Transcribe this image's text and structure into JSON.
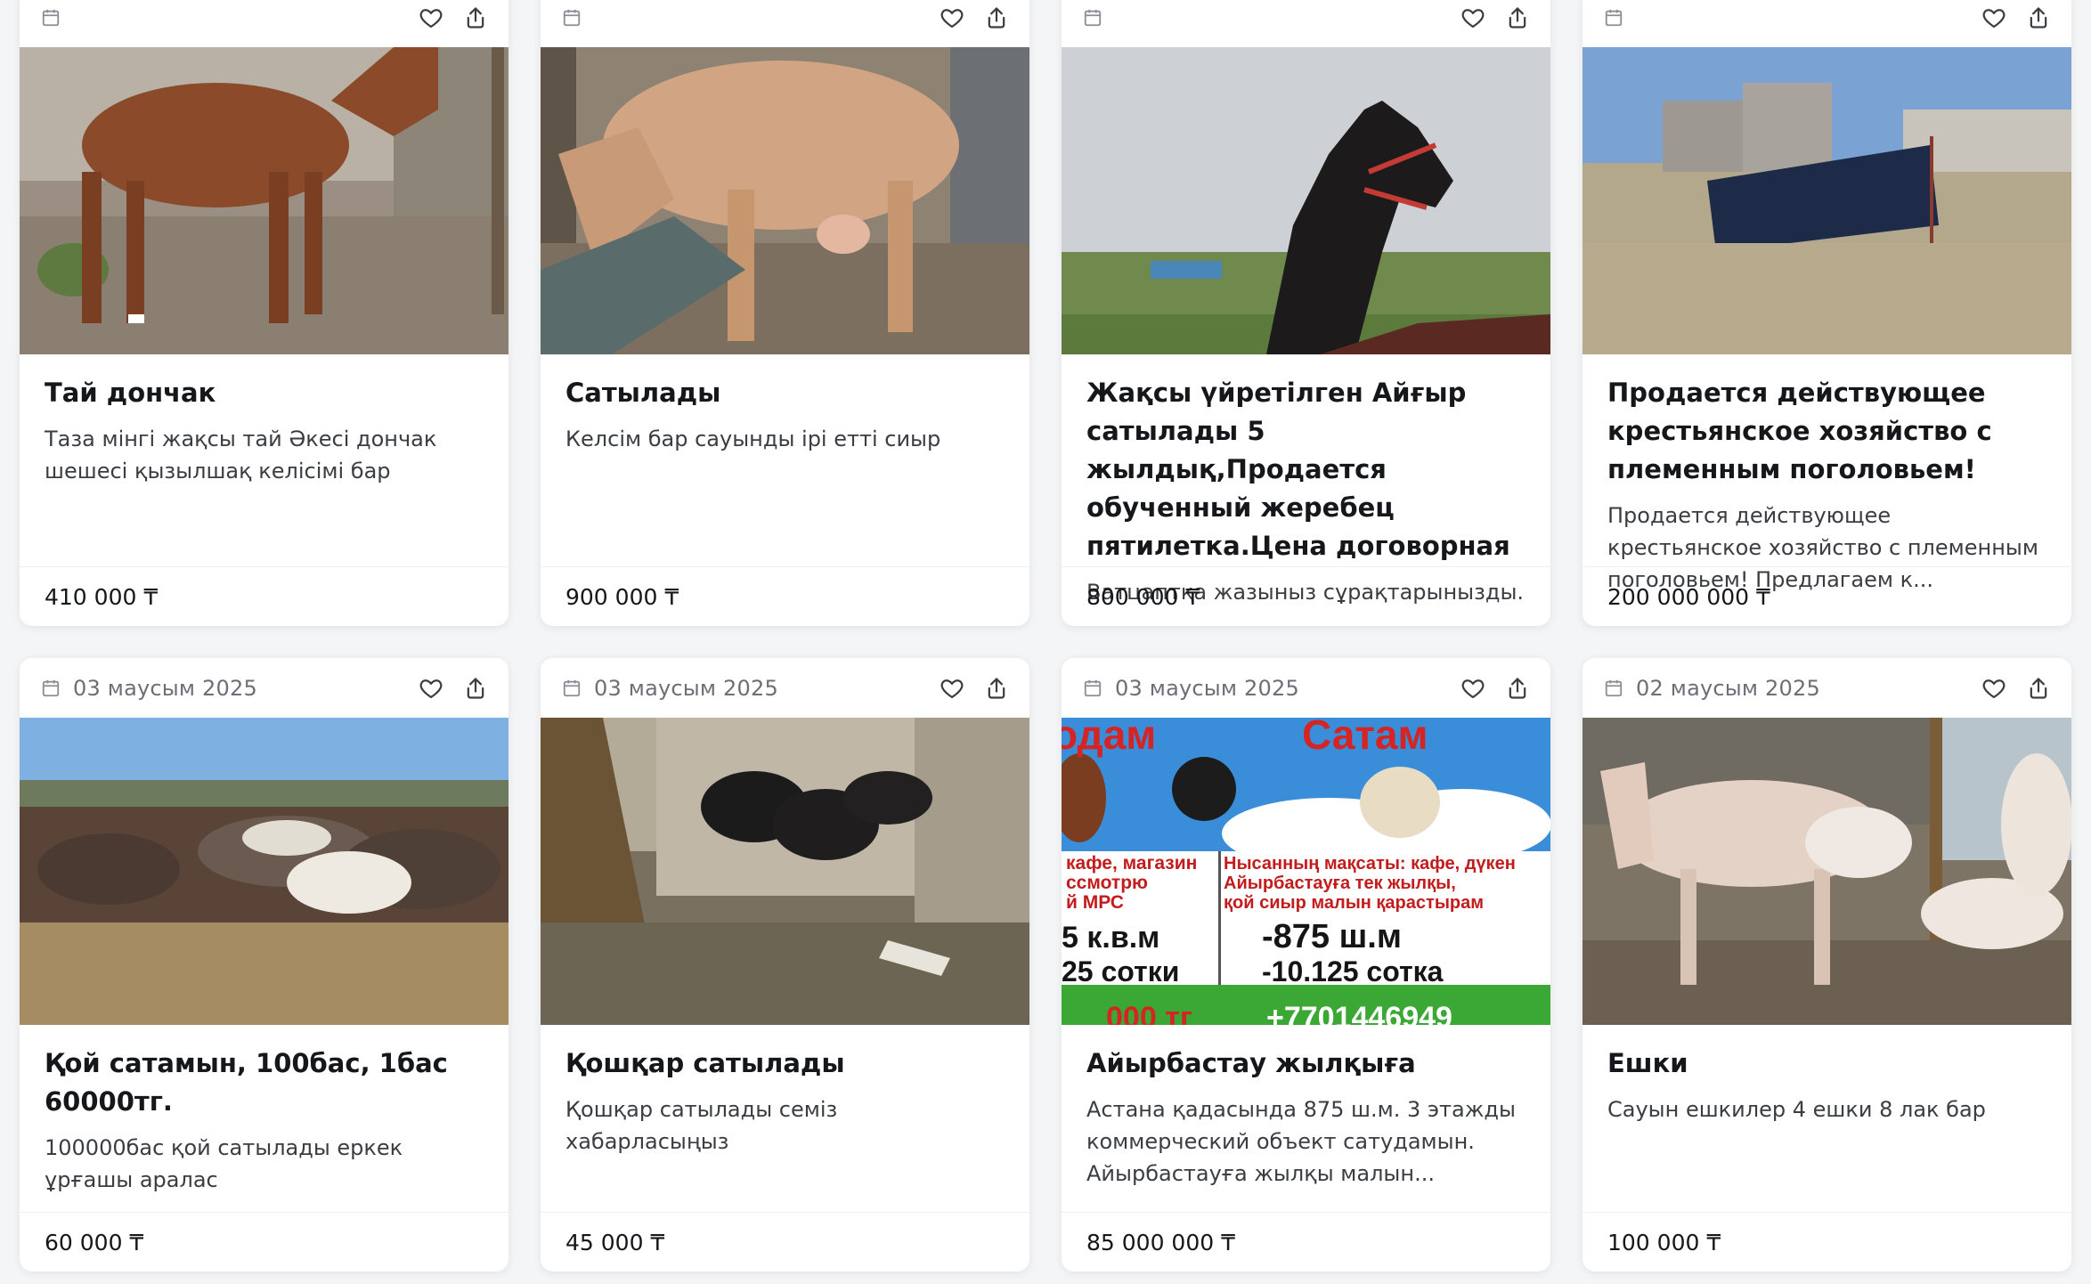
{
  "icons": {
    "calendar": "calendar-icon",
    "favorite": "heart-icon",
    "share": "share-icon"
  },
  "listings": [
    {
      "date": "",
      "title": "Тай дончак",
      "description": "Таза мінгі жақсы тай Әкесі дончак шешесі қызылшақ келісімі бар",
      "price": "410 000 ₸"
    },
    {
      "date": "",
      "title": "Сатылады",
      "description": "Келсім бар сауынды ірі етті сиыр",
      "price": "900 000 ₸"
    },
    {
      "date": "",
      "title": "Жақсы үйретілген Айғыр сатылады 5 жылдық,Продается обученный жеребец пятилетка.Цена договорная",
      "description": "Ватцаптқа жазыныз сұрақтарынызды.",
      "price": "800 000 ₸"
    },
    {
      "date": "",
      "title": "Продается действующее крестьянское хозяйство с племенным поголовьем!",
      "description": "Продается действующее крестьянское хозяйство с племенным поголовьем! Предлагаем к...",
      "price": "200 000 000 ₸"
    },
    {
      "date": "03 маусым 2025",
      "title": "Қой сатамын, 100бас, 1бас 60000тг.",
      "description": "100000бас қой сатылады еркек ұрғашы аралас",
      "price": "60 000 ₸"
    },
    {
      "date": "03 маусым 2025",
      "title": "Қошқар сатылады",
      "description": "Қошқар сатылады семіз хабарласыңыз",
      "price": "45 000 ₸"
    },
    {
      "date": "03 маусым 2025",
      "title": "Айырбастау жылқыға",
      "description": "Астана қадасында 875 ш.м. 3 этажды коммерческий объект сатудамын. Айырбастауға жылқы малын...",
      "price": "85 000 000 ₸"
    },
    {
      "date": "02 маусым 2025",
      "title": "Ешки",
      "description": "Сауын ешкилер 4 ешки 8 лак бар",
      "price": "100 000 ₸"
    }
  ],
  "ad_banner": {
    "heading_left": "одам",
    "heading_right": "Сатам",
    "left_line1": "кафе, магазин",
    "left_line2": "ссмотрю",
    "left_line3": "й МРС",
    "left_area": "5 к.в.м",
    "left_sotka": "25 сотки",
    "right_line1": "Нысанның мақсаты: кафе, дүкен",
    "right_line2": "Айырбастауға тек жылқы,",
    "right_line3": "қой сиыр малын қарастырам",
    "right_area": "-875 ш.м",
    "right_sotka": "-10.125 сотка",
    "bottom_left": "000 тг",
    "bottom_right": "+7701446949"
  }
}
